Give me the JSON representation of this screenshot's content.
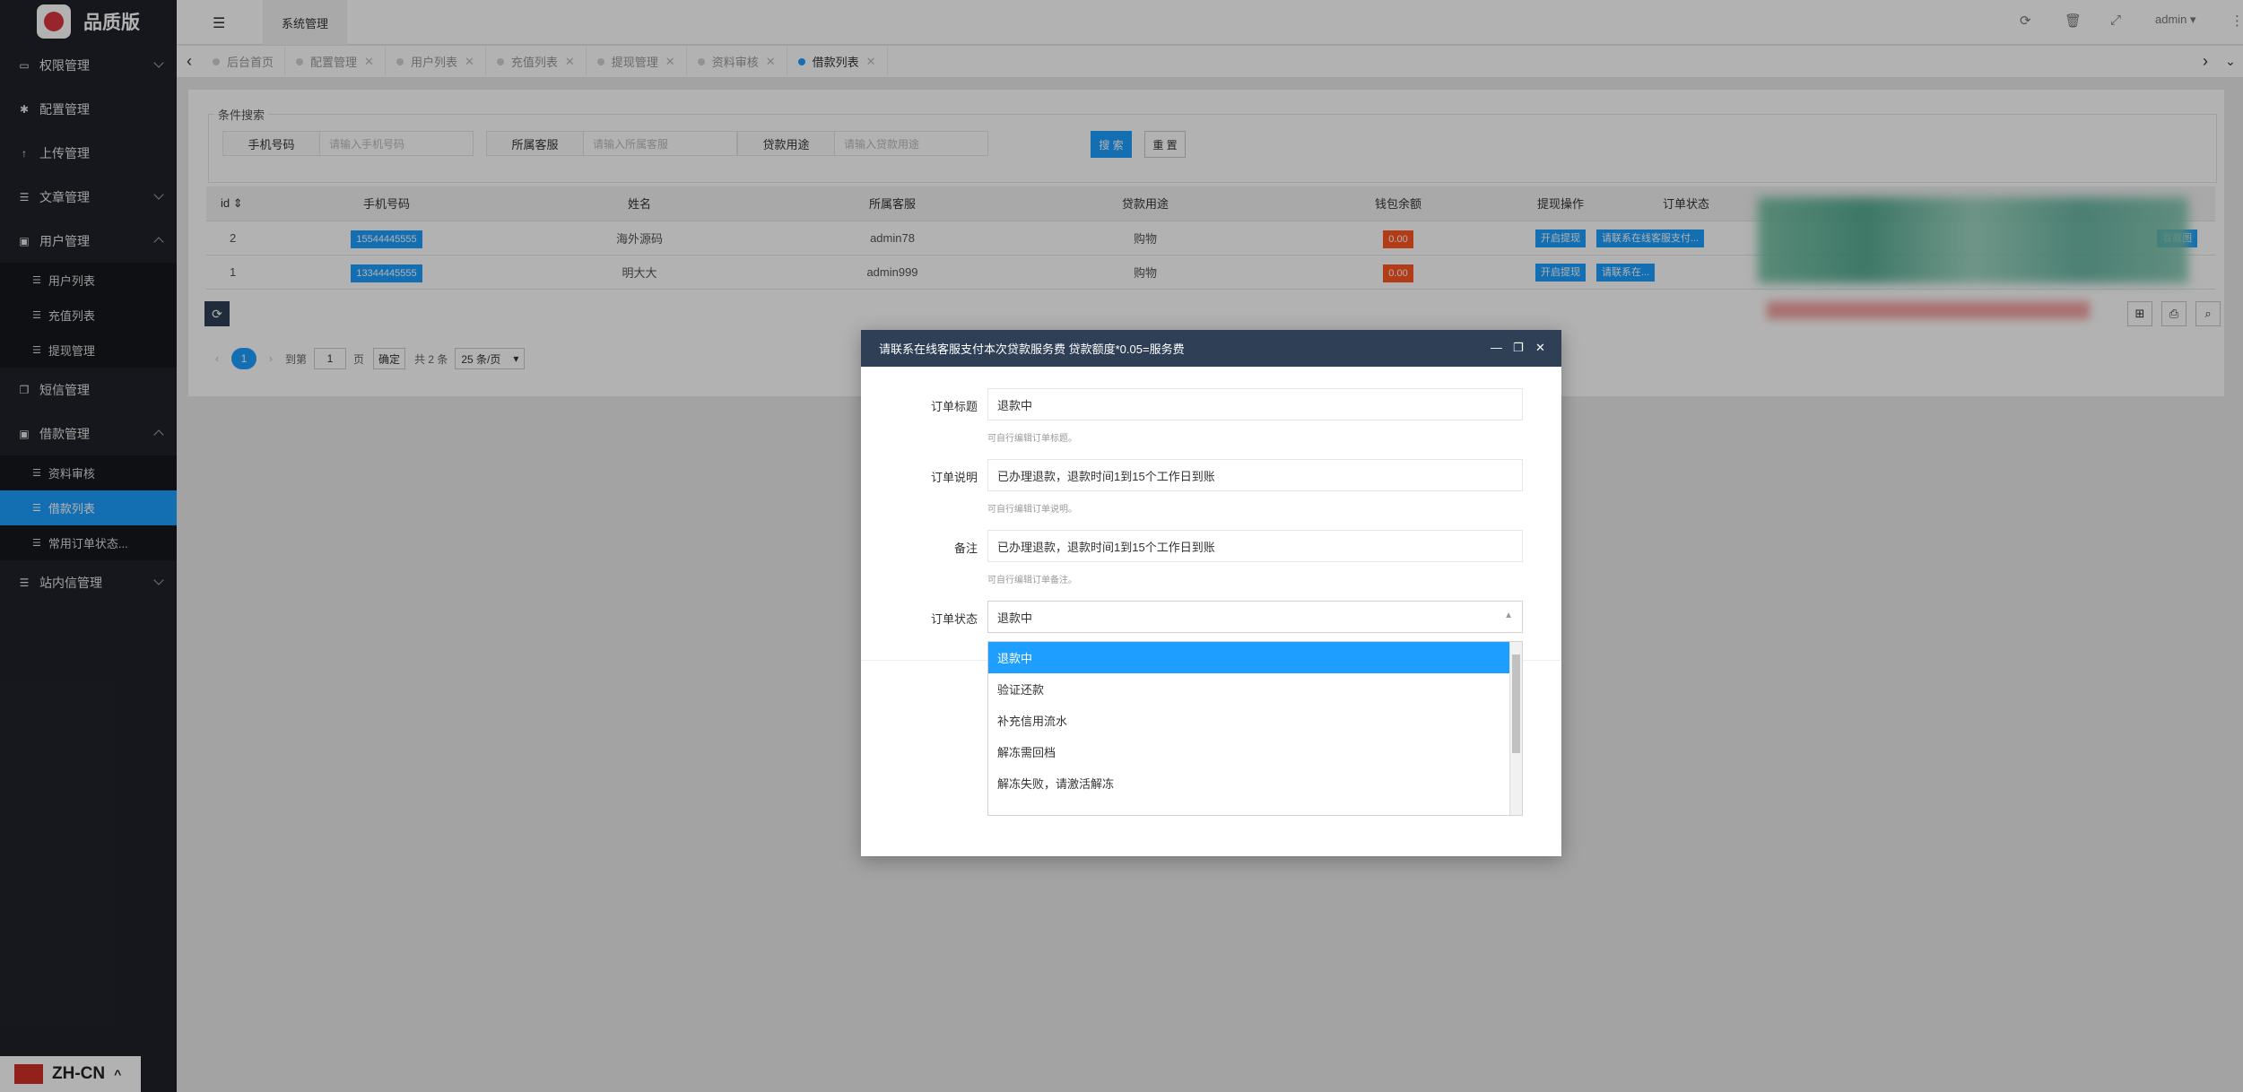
{
  "brand": {
    "name": "品质版"
  },
  "sidebar": {
    "items": [
      {
        "label": "权限管理",
        "icon": "laptop-icon"
      },
      {
        "label": "配置管理",
        "icon": "gear-icon"
      },
      {
        "label": "上传管理",
        "icon": "upload-icon"
      },
      {
        "label": "文章管理",
        "icon": "list-icon"
      },
      {
        "label": "用户管理",
        "icon": "user-icon"
      },
      {
        "label": "短信管理",
        "icon": "sms-icon"
      },
      {
        "label": "借款管理",
        "icon": "money-icon"
      },
      {
        "label": "站内信管理",
        "icon": "list-icon"
      }
    ],
    "user_sub": [
      "用户列表",
      "充值列表",
      "提现管理"
    ],
    "loan_sub": [
      "资料审核",
      "借款列表",
      "常用订单状态..."
    ]
  },
  "language": {
    "label": "ZH-CN"
  },
  "header": {
    "tab": "系统管理",
    "user": "admin"
  },
  "tabs": [
    "后台首页",
    "配置管理",
    "用户列表",
    "充值列表",
    "提现管理",
    "资料审核",
    "借款列表"
  ],
  "search": {
    "legend": "条件搜索",
    "fields": [
      {
        "label": "手机号码",
        "placeholder": "请输入手机号码"
      },
      {
        "label": "所属客服",
        "placeholder": "请输入所属客服"
      },
      {
        "label": "贷款用途",
        "placeholder": "请输入贷款用途"
      }
    ],
    "search_btn": "搜 索",
    "reset_btn": "重 置"
  },
  "table": {
    "headers": [
      "id",
      "手机号码",
      "姓名",
      "所属客服",
      "贷款用途",
      "钱包余额",
      "提现操作",
      "订单状态"
    ],
    "rows": [
      {
        "id": "2",
        "phone": "15544445555",
        "name": "海外源码",
        "agent": "admin78",
        "purpose": "购物",
        "balance": "0.00",
        "op": "开启提现",
        "status": "请联系在线客服支付..."
      },
      {
        "id": "1",
        "phone": "13344445555",
        "name": "明大大",
        "agent": "admin999",
        "purpose": "购物",
        "balance": "0.00",
        "op": "开启提现",
        "status": "请联系在..."
      }
    ],
    "extra_link": "看截图"
  },
  "pager": {
    "current": "1",
    "goto": "到第",
    "page_input": "1",
    "page_unit": "页",
    "confirm": "确定",
    "total": "共 2 条",
    "per_page": "25 条/页"
  },
  "modal": {
    "title": "请联系在线客服支付本次贷款服务费 贷款额度*0.05=服务费",
    "fields": [
      {
        "label": "订单标题",
        "value": "退款中",
        "hint": "可自行编辑订单标题。"
      },
      {
        "label": "订单说明",
        "value": "已办理退款，退款时间1到15个工作日到账",
        "hint": "可自行编辑订单说明。"
      },
      {
        "label": "备注",
        "value": "已办理退款，退款时间1到15个工作日到账",
        "hint": "可自行编辑订单备注。"
      }
    ],
    "status_label": "订单状态",
    "status_value": "退款中",
    "options": [
      "退款中",
      "验证还款",
      "补充信用流水",
      "解冻需回档",
      "解冻失败，请激活解冻"
    ]
  }
}
